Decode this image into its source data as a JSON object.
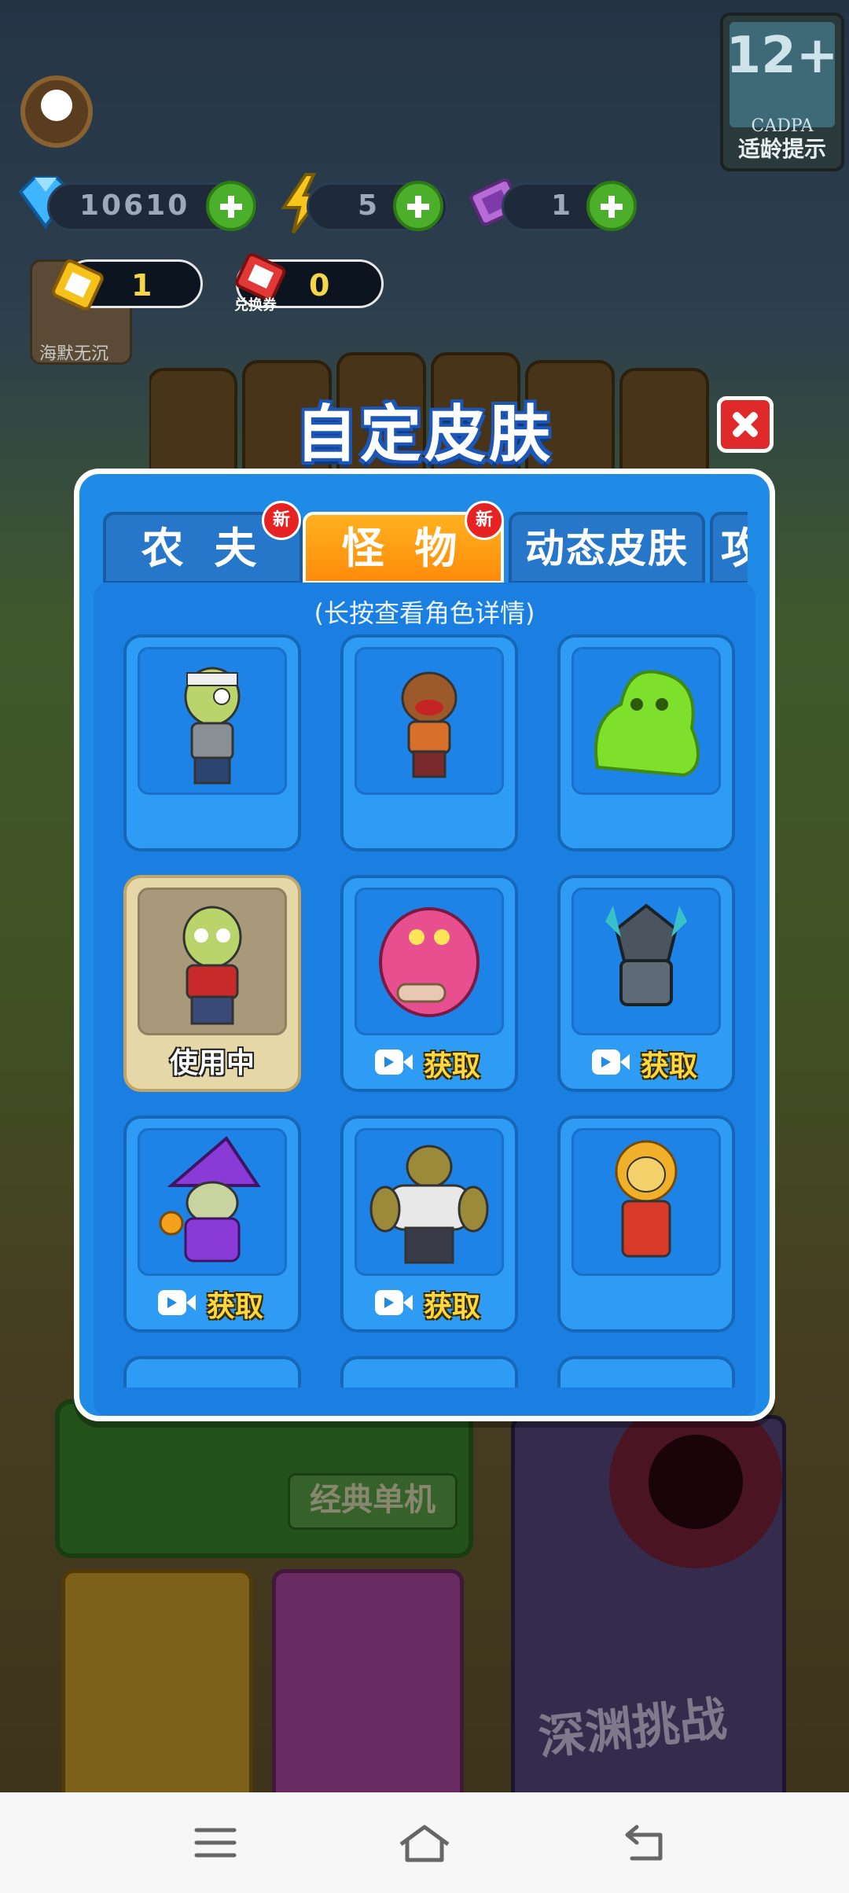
{
  "top": {
    "currency": [
      {
        "name": "gem",
        "value": "10610"
      },
      {
        "name": "energy",
        "value": "5"
      },
      {
        "name": "ticket",
        "value": "1"
      }
    ],
    "vouchers": [
      {
        "name": "gold-ticket",
        "value": "1"
      },
      {
        "name": "exchange-voucher",
        "value": "0",
        "label": "兑换券"
      }
    ],
    "player_name": "海默无沉",
    "age_rating": {
      "number": "12+",
      "org": "CADPA",
      "label": "适龄提示"
    }
  },
  "modal": {
    "title": "自定皮肤",
    "tabs": [
      {
        "label": "农 夫",
        "badge": "新",
        "active": false
      },
      {
        "label": "怪 物",
        "badge": "新",
        "active": true
      },
      {
        "label": "动态皮肤",
        "badge": "",
        "active": false
      },
      {
        "label": "攻",
        "badge": "",
        "active": false
      }
    ],
    "hint": "(长按查看角色详情)",
    "skins": [
      {
        "character": "bandaged zombie",
        "status": ""
      },
      {
        "character": "orange zombie",
        "status": ""
      },
      {
        "character": "green slime",
        "status": ""
      },
      {
        "character": "classic zombie",
        "status": "使用中"
      },
      {
        "character": "pink fish monster",
        "status": "获取"
      },
      {
        "character": "armored knight",
        "status": "获取"
      },
      {
        "character": "zombie wizard",
        "status": "获取"
      },
      {
        "character": "muscle zombie",
        "status": "获取"
      },
      {
        "character": "lion zombie",
        "status": ""
      }
    ]
  },
  "background": {
    "classic_mode": "经典单机",
    "abyss_mode": "深渊挑战"
  },
  "colors": {
    "panel_blue": "#1f8be6",
    "active_tab": "#ff9a12",
    "get_text": "#ffd93b",
    "close_red": "#e02a2a"
  }
}
